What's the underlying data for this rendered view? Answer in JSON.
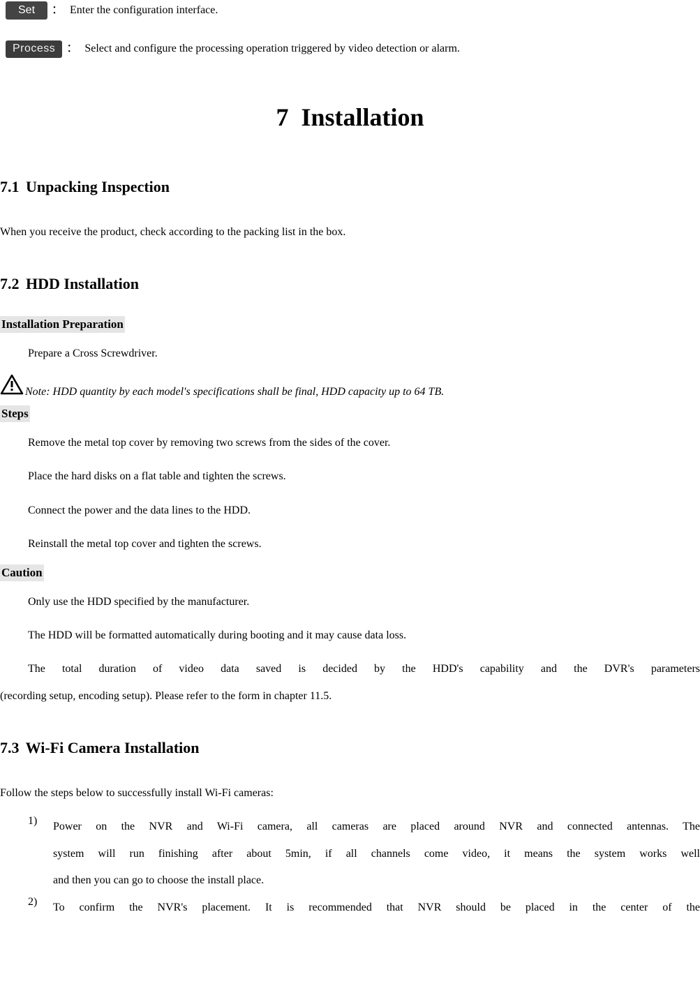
{
  "buttons": {
    "set_label": "Set",
    "set_desc": "Enter the configuration interface.",
    "process_label": "Process",
    "process_desc": "Select and configure the processing operation triggered by video detection or alarm."
  },
  "chapter": {
    "number": "7",
    "title": "Installation"
  },
  "s71": {
    "num": "7.1",
    "title": "Unpacking Inspection",
    "body": "When you receive the product, check according to the packing list in the box."
  },
  "s72": {
    "num": "7.2",
    "title": "HDD Installation",
    "prep_heading": "Installation Preparation",
    "prep_body": "Prepare a Cross Screwdriver.",
    "note": "Note: HDD quantity by each model's specifications shall be final, HDD capacity up to 64 TB.",
    "steps_heading": "Steps",
    "steps": [
      "Remove the metal top cover by removing two screws from the sides of the cover.",
      "Place the hard disks on a flat table and tighten the screws.",
      "Connect the power and the data lines to the HDD.",
      "Reinstall the metal top cover and tighten the screws."
    ],
    "caution_heading": "Caution",
    "caution": [
      "Only use the HDD specified by the manufacturer.",
      "The HDD will be formatted automatically during booting and it may cause data loss."
    ],
    "caution_long_a": "The total duration of video data saved is decided by the HDD's capability and the DVR's parameters",
    "caution_long_b": "(recording setup, encoding setup). Please refer to the form in chapter 11.5."
  },
  "s73": {
    "num": "7.3",
    "title": "Wi-Fi Camera Installation",
    "intro": "Follow the steps below to successfully install Wi-Fi cameras:",
    "items": [
      {
        "n": "1)",
        "lines": [
          "Power on the NVR and Wi-Fi camera, all cameras are placed around NVR and connected antennas. The",
          "system will run finishing after about 5min, if all channels come video, it means the system works well"
        ],
        "last": "and then you can go to choose the install place."
      },
      {
        "n": "2)",
        "lines": [
          "To confirm the NVR's placement. It is recommended that NVR should be placed in the center of the"
        ],
        "last": ""
      }
    ]
  }
}
